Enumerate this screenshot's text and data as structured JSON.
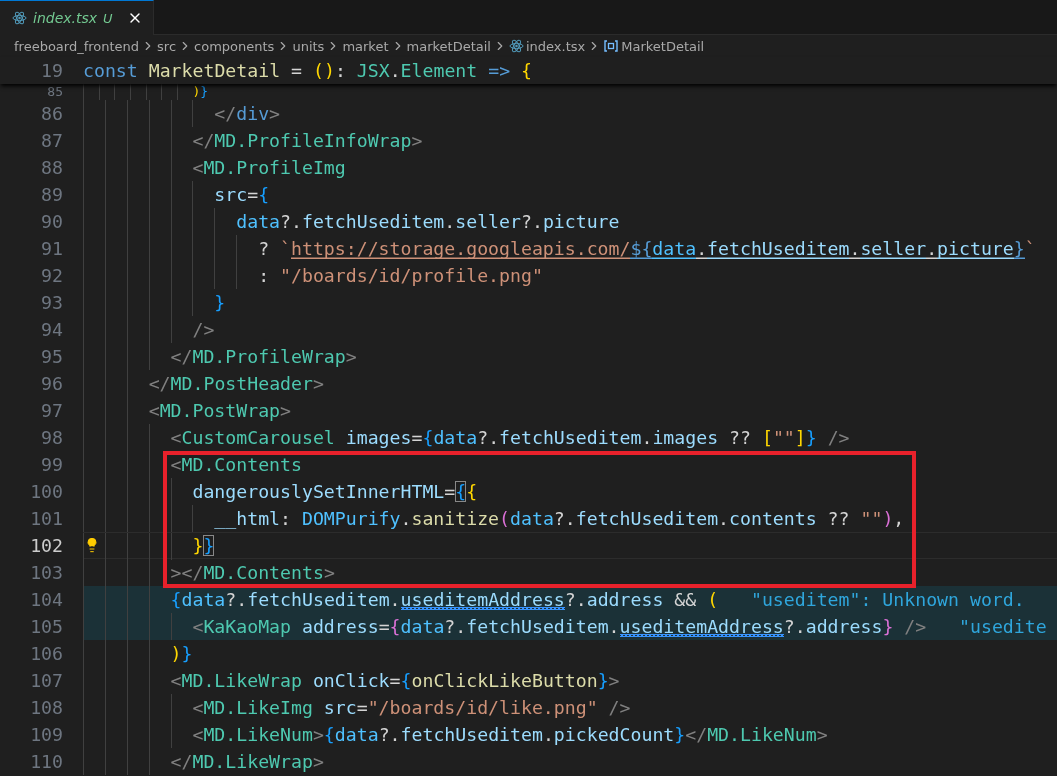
{
  "tab": {
    "title": "index.tsx",
    "badge": "U",
    "selected": true
  },
  "breadcrumbs": [
    {
      "label": "freeboard_frontend",
      "kind": "folder"
    },
    {
      "label": "src",
      "kind": "folder"
    },
    {
      "label": "components",
      "kind": "folder"
    },
    {
      "label": "units",
      "kind": "folder"
    },
    {
      "label": "market",
      "kind": "folder"
    },
    {
      "label": "marketDetail",
      "kind": "folder"
    },
    {
      "label": "index.tsx",
      "kind": "file"
    },
    {
      "label": "MarketDetail",
      "kind": "symbol"
    }
  ],
  "sticky_line": {
    "number": "19",
    "tokens": [
      {
        "kind": "kw",
        "text": "const "
      },
      {
        "kind": "fn",
        "text": "MarketDetail"
      },
      {
        "kind": "op",
        "text": " = "
      },
      {
        "kind": "br1",
        "text": "("
      },
      {
        "kind": "br1",
        "text": ")"
      },
      {
        "kind": "op",
        "text": ": "
      },
      {
        "kind": "type",
        "text": "JSX"
      },
      {
        "kind": "op",
        "text": "."
      },
      {
        "kind": "type",
        "text": "Element"
      },
      {
        "kind": "kw",
        "text": " => "
      },
      {
        "kind": "br1",
        "text": "{"
      }
    ]
  },
  "lines": [
    {
      "number": "85",
      "partial": true,
      "tokens": [
        {
          "kind": "br1",
          "text": "              )"
        },
        {
          "kind": "br3",
          "text": "}"
        }
      ]
    },
    {
      "number": "86",
      "tokens": [
        {
          "kind": "angle",
          "text": "            </"
        },
        {
          "kind": "kw",
          "text": "div"
        },
        {
          "kind": "angle",
          "text": ">"
        }
      ]
    },
    {
      "number": "87",
      "tokens": [
        {
          "kind": "angle",
          "text": "          </"
        },
        {
          "kind": "tag",
          "text": "MD.ProfileInfoWrap"
        },
        {
          "kind": "angle",
          "text": ">"
        }
      ]
    },
    {
      "number": "88",
      "tokens": [
        {
          "kind": "angle",
          "text": "          <"
        },
        {
          "kind": "tag",
          "text": "MD.ProfileImg"
        }
      ]
    },
    {
      "number": "89",
      "tokens": [
        {
          "kind": "var",
          "text": "            src"
        },
        {
          "kind": "op",
          "text": "="
        },
        {
          "kind": "br3",
          "text": "{"
        }
      ]
    },
    {
      "number": "90",
      "tokens": [
        {
          "kind": "const",
          "text": "              data"
        },
        {
          "kind": "op",
          "text": "?."
        },
        {
          "kind": "var",
          "text": "fetchUseditem"
        },
        {
          "kind": "op",
          "text": "."
        },
        {
          "kind": "var",
          "text": "seller"
        },
        {
          "kind": "op",
          "text": "?."
        },
        {
          "kind": "var",
          "text": "picture"
        }
      ]
    },
    {
      "number": "91",
      "tokens": [
        {
          "kind": "op",
          "text": "                ? "
        },
        {
          "kind": "str",
          "text": "`"
        },
        {
          "kind": "str",
          "text": "https://storage.googleapis.com/",
          "underline": true
        },
        {
          "kind": "kw",
          "text": "${",
          "underline": true
        },
        {
          "kind": "const",
          "text": "data",
          "underline": true
        },
        {
          "kind": "op",
          "text": ".",
          "underline": true
        },
        {
          "kind": "var",
          "text": "fetchUseditem",
          "underline": true
        },
        {
          "kind": "op",
          "text": ".",
          "underline": true
        },
        {
          "kind": "var",
          "text": "seller",
          "underline": true
        },
        {
          "kind": "op",
          "text": ".",
          "underline": true
        },
        {
          "kind": "var",
          "text": "picture",
          "underline": true
        },
        {
          "kind": "kw",
          "text": "}",
          "underline": true
        },
        {
          "kind": "str",
          "text": "`"
        }
      ]
    },
    {
      "number": "92",
      "tokens": [
        {
          "kind": "op",
          "text": "                : "
        },
        {
          "kind": "str",
          "text": "\"/boards/id/profile.png\""
        }
      ]
    },
    {
      "number": "93",
      "tokens": [
        {
          "kind": "br3",
          "text": "            }"
        }
      ]
    },
    {
      "number": "94",
      "tokens": [
        {
          "kind": "angle",
          "text": "          />"
        }
      ]
    },
    {
      "number": "95",
      "tokens": [
        {
          "kind": "angle",
          "text": "        </"
        },
        {
          "kind": "tag",
          "text": "MD.ProfileWrap"
        },
        {
          "kind": "angle",
          "text": ">"
        }
      ]
    },
    {
      "number": "96",
      "tokens": [
        {
          "kind": "angle",
          "text": "      </"
        },
        {
          "kind": "tag",
          "text": "MD.PostHeader"
        },
        {
          "kind": "angle",
          "text": ">"
        }
      ]
    },
    {
      "number": "97",
      "tokens": [
        {
          "kind": "angle",
          "text": "      <"
        },
        {
          "kind": "tag",
          "text": "MD.PostWrap"
        },
        {
          "kind": "angle",
          "text": ">"
        }
      ]
    },
    {
      "number": "98",
      "tokens": [
        {
          "kind": "angle",
          "text": "        <"
        },
        {
          "kind": "tag",
          "text": "CustomCarousel "
        },
        {
          "kind": "var",
          "text": "images"
        },
        {
          "kind": "op",
          "text": "="
        },
        {
          "kind": "br3",
          "text": "{"
        },
        {
          "kind": "const",
          "text": "data"
        },
        {
          "kind": "op",
          "text": "?."
        },
        {
          "kind": "var",
          "text": "fetchUseditem"
        },
        {
          "kind": "op",
          "text": "."
        },
        {
          "kind": "var",
          "text": "images"
        },
        {
          "kind": "op",
          "text": " ?? "
        },
        {
          "kind": "br1",
          "text": "["
        },
        {
          "kind": "str",
          "text": "\"\""
        },
        {
          "kind": "br1",
          "text": "]"
        },
        {
          "kind": "br3",
          "text": "}"
        },
        {
          "kind": "angle",
          "text": " />"
        }
      ]
    },
    {
      "number": "99",
      "boxed": true,
      "tokens": [
        {
          "kind": "angle",
          "text": "        <"
        },
        {
          "kind": "tag",
          "text": "MD.Contents"
        }
      ]
    },
    {
      "number": "100",
      "boxed": true,
      "tokens": [
        {
          "kind": "var",
          "text": "          dangerouslySetInnerHTML"
        },
        {
          "kind": "op",
          "text": "="
        },
        {
          "kind": "br3",
          "text": "{",
          "matched": true
        },
        {
          "kind": "br1",
          "text": "{"
        }
      ]
    },
    {
      "number": "101",
      "boxed": true,
      "tokens": [
        {
          "kind": "var",
          "text": "            __html"
        },
        {
          "kind": "op",
          "text": ": "
        },
        {
          "kind": "const",
          "text": "DOMPurify"
        },
        {
          "kind": "op",
          "text": "."
        },
        {
          "kind": "fn",
          "text": "sanitize"
        },
        {
          "kind": "br2",
          "text": "("
        },
        {
          "kind": "const",
          "text": "data"
        },
        {
          "kind": "op",
          "text": "?."
        },
        {
          "kind": "var",
          "text": "fetchUseditem"
        },
        {
          "kind": "op",
          "text": "."
        },
        {
          "kind": "var",
          "text": "contents"
        },
        {
          "kind": "op",
          "text": " ?? "
        },
        {
          "kind": "str",
          "text": "\"\""
        },
        {
          "kind": "br2",
          "text": ")"
        },
        {
          "kind": "op",
          "text": ","
        }
      ]
    },
    {
      "number": "102",
      "boxed": true,
      "current": true,
      "lightbulb": true,
      "tokens": [
        {
          "kind": "br1",
          "text": "          }"
        },
        {
          "kind": "br3",
          "text": "}",
          "matched": true
        }
      ]
    },
    {
      "number": "103",
      "boxed": true,
      "tokens": [
        {
          "kind": "angle",
          "text": "        >"
        },
        {
          "kind": "angle",
          "text": "</"
        },
        {
          "kind": "tag",
          "text": "MD.Contents"
        },
        {
          "kind": "angle",
          "text": ">"
        }
      ]
    },
    {
      "number": "104",
      "highlighted": true,
      "hint": "\"useditem\": Unknown word.",
      "tokens": [
        {
          "kind": "br3",
          "text": "        {"
        },
        {
          "kind": "const",
          "text": "data"
        },
        {
          "kind": "op",
          "text": "?."
        },
        {
          "kind": "var",
          "text": "fetchUseditem"
        },
        {
          "kind": "op",
          "text": "."
        },
        {
          "kind": "var",
          "text": "useditemAddress",
          "squiggle": true
        },
        {
          "kind": "op",
          "text": "?."
        },
        {
          "kind": "var",
          "text": "address"
        },
        {
          "kind": "op",
          "text": " && "
        },
        {
          "kind": "br1",
          "text": "("
        }
      ]
    },
    {
      "number": "105",
      "highlighted": true,
      "hint": "\"usedite",
      "tokens": [
        {
          "kind": "angle",
          "text": "          <"
        },
        {
          "kind": "tag",
          "text": "KaKaoMap "
        },
        {
          "kind": "var",
          "text": "address"
        },
        {
          "kind": "op",
          "text": "="
        },
        {
          "kind": "br2",
          "text": "{"
        },
        {
          "kind": "const",
          "text": "data"
        },
        {
          "kind": "op",
          "text": "?."
        },
        {
          "kind": "var",
          "text": "fetchUseditem"
        },
        {
          "kind": "op",
          "text": "."
        },
        {
          "kind": "var",
          "text": "useditemAddress",
          "squiggle": true
        },
        {
          "kind": "op",
          "text": "?."
        },
        {
          "kind": "var",
          "text": "address"
        },
        {
          "kind": "br2",
          "text": "}"
        },
        {
          "kind": "angle",
          "text": " />"
        }
      ]
    },
    {
      "number": "106",
      "tokens": [
        {
          "kind": "br1",
          "text": "        )"
        },
        {
          "kind": "br3",
          "text": "}"
        }
      ]
    },
    {
      "number": "107",
      "tokens": [
        {
          "kind": "angle",
          "text": "        <"
        },
        {
          "kind": "tag",
          "text": "MD.LikeWrap "
        },
        {
          "kind": "var",
          "text": "onClick"
        },
        {
          "kind": "op",
          "text": "="
        },
        {
          "kind": "br3",
          "text": "{"
        },
        {
          "kind": "fn",
          "text": "onClickLikeButton"
        },
        {
          "kind": "br3",
          "text": "}"
        },
        {
          "kind": "angle",
          "text": ">"
        }
      ]
    },
    {
      "number": "108",
      "tokens": [
        {
          "kind": "angle",
          "text": "          <"
        },
        {
          "kind": "tag",
          "text": "MD.LikeImg "
        },
        {
          "kind": "var",
          "text": "src"
        },
        {
          "kind": "op",
          "text": "="
        },
        {
          "kind": "str",
          "text": "\"/boards/id/like.png\""
        },
        {
          "kind": "angle",
          "text": " />"
        }
      ]
    },
    {
      "number": "109",
      "tokens": [
        {
          "kind": "angle",
          "text": "          <"
        },
        {
          "kind": "tag",
          "text": "MD.LikeNum"
        },
        {
          "kind": "angle",
          "text": ">"
        },
        {
          "kind": "br3",
          "text": "{"
        },
        {
          "kind": "const",
          "text": "data"
        },
        {
          "kind": "op",
          "text": "?."
        },
        {
          "kind": "var",
          "text": "fetchUseditem"
        },
        {
          "kind": "op",
          "text": "."
        },
        {
          "kind": "var",
          "text": "pickedCount"
        },
        {
          "kind": "br3",
          "text": "}"
        },
        {
          "kind": "angle",
          "text": "</"
        },
        {
          "kind": "tag",
          "text": "MD.LikeNum"
        },
        {
          "kind": "angle",
          "text": ">"
        }
      ]
    },
    {
      "number": "110",
      "tokens": [
        {
          "kind": "angle",
          "text": "        </"
        },
        {
          "kind": "tag",
          "text": "MD.LikeWrap"
        },
        {
          "kind": "angle",
          "text": ">"
        }
      ]
    }
  ]
}
